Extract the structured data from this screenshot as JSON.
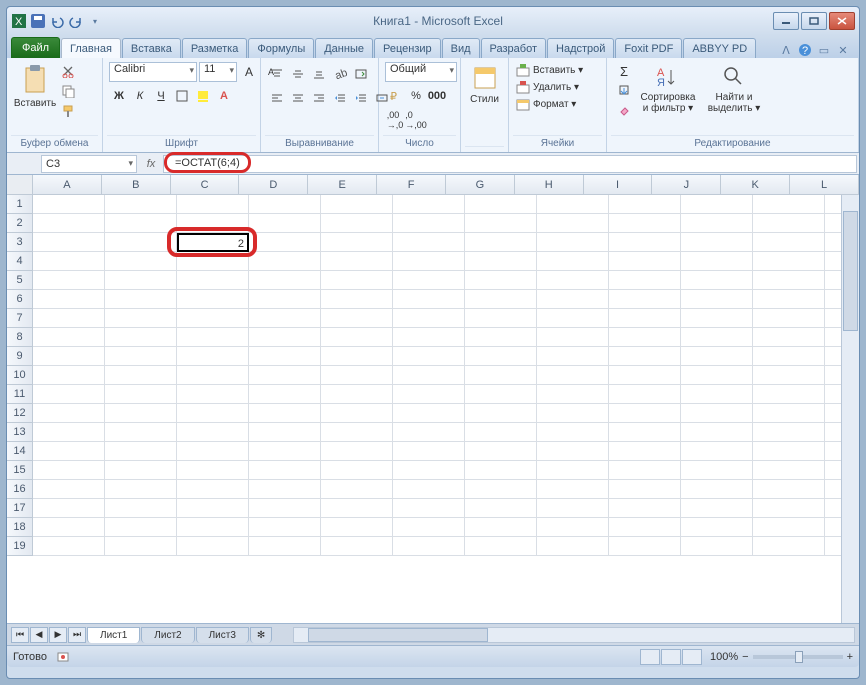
{
  "title": "Книга1 - Microsoft Excel",
  "tabs": {
    "file": "Файл",
    "home": "Главная",
    "insert": "Вставка",
    "layout": "Разметка",
    "formulas": "Формулы",
    "data": "Данные",
    "review": "Рецензир",
    "view": "Вид",
    "dev": "Разработ",
    "addins": "Надстрой",
    "foxit": "Foxit PDF",
    "abbyy": "ABBYY PD"
  },
  "groups": {
    "clipboard": "Буфер обмена",
    "font": "Шрифт",
    "align": "Выравнивание",
    "number": "Число",
    "styles": "Стили",
    "cells": "Ячейки",
    "editing": "Редактирование"
  },
  "ribbon": {
    "paste": "Вставить",
    "font_name": "Calibri",
    "font_size": "11",
    "number_format": "Общий",
    "styles": "Стили",
    "insert": "Вставить ▾",
    "delete": "Удалить ▾",
    "format": "Формат ▾",
    "sort": "Сортировка\nи фильтр ▾",
    "find": "Найти и\nвыделить ▾"
  },
  "namebox": "C3",
  "formula": "=ОСТАТ(6;4)",
  "columns": [
    "A",
    "B",
    "C",
    "D",
    "E",
    "F",
    "G",
    "H",
    "I",
    "J",
    "K",
    "L"
  ],
  "rows": [
    "1",
    "2",
    "3",
    "4",
    "5",
    "6",
    "7",
    "8",
    "9",
    "10",
    "11",
    "12",
    "13",
    "14",
    "15",
    "16",
    "17",
    "18",
    "19"
  ],
  "active_cell": {
    "col": 2,
    "row": 2,
    "value": "2"
  },
  "sheets": {
    "s1": "Лист1",
    "s2": "Лист2",
    "s3": "Лист3"
  },
  "status": "Готово",
  "zoom": "100%"
}
